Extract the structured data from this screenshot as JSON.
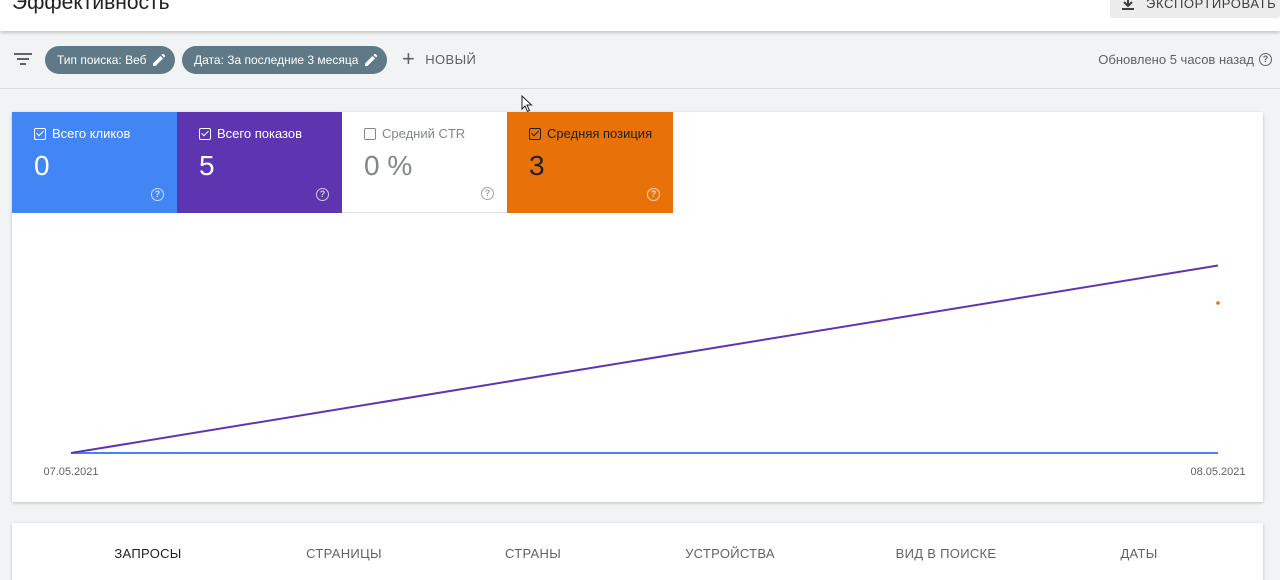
{
  "header": {
    "title": "Эффективность",
    "export_label": "ЭКСПОРТИРОВАТЬ"
  },
  "filters": {
    "chips": [
      {
        "label": "Тип поиска: Веб"
      },
      {
        "label": "Дата: За последние 3 месяца"
      }
    ],
    "new_label": "НОВЫЙ",
    "updated_text": "Обновлено 5 часов назад"
  },
  "metrics": [
    {
      "label": "Всего кликов",
      "value": "0",
      "checked": true,
      "color": "#4285f4"
    },
    {
      "label": "Всего показов",
      "value": "5",
      "checked": true,
      "color": "#5e35b1"
    },
    {
      "label": "Средний CTR",
      "value": "0 %",
      "checked": false,
      "color": "#ffffff"
    },
    {
      "label": "Средняя позиция",
      "value": "3",
      "checked": true,
      "color": "#e8710a"
    }
  ],
  "chart_data": {
    "type": "line",
    "x": [
      "07.05.2021",
      "08.05.2021"
    ],
    "series": [
      {
        "name": "Всего кликов",
        "values": [
          0,
          0
        ],
        "color": "#4285f4"
      },
      {
        "name": "Всего показов",
        "values": [
          0,
          5
        ],
        "color": "#5e35b1"
      },
      {
        "name": "Средняя позиция",
        "values": [
          null,
          3
        ],
        "color": "#e8710a"
      }
    ],
    "grid": false
  },
  "tabs": [
    {
      "label": "ЗАПРОСЫ",
      "active": true
    },
    {
      "label": "СТРАНИЦЫ",
      "active": false
    },
    {
      "label": "СТРАНЫ",
      "active": false
    },
    {
      "label": "УСТРОЙСТВА",
      "active": false
    },
    {
      "label": "ВИД В ПОИСКЕ",
      "active": false
    },
    {
      "label": "ДАТЫ",
      "active": false
    }
  ]
}
